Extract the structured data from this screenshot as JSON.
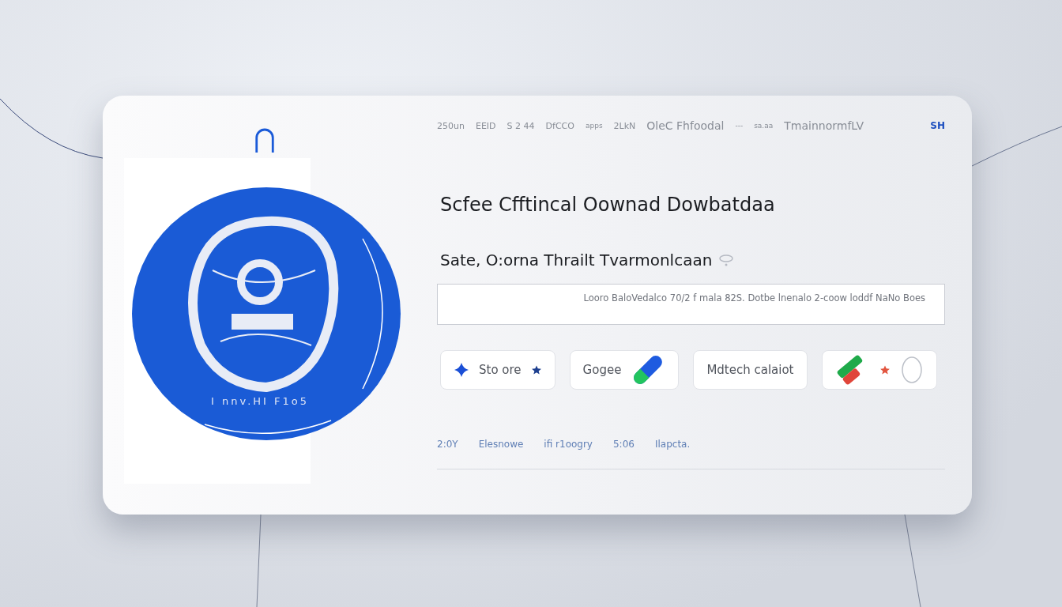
{
  "nav": {
    "items": [
      "250un",
      "EEID",
      "S 2 44",
      "DfCCO",
      "apps",
      "2LkN",
      "OleC Fhfoodal",
      "---",
      "sa.aa",
      "TmainnormfLV"
    ],
    "badge": "SH"
  },
  "emblem": {
    "caption": "I nnv.HI F1o5"
  },
  "heading": "Scfee Cfftincal Oownad Dowbatdaa",
  "subheading": "Sate, O:orna Thrailt Tvarmonlcaan",
  "field": {
    "value": "Looro BaloVedalco 70/2 f mala 82S. Dotbe lnenalo 2-coow loddf NaNo Boes"
  },
  "buttons": [
    {
      "kind": "diamond",
      "label": "Sto ore"
    },
    {
      "kind": "pill",
      "label": "Gogee"
    },
    {
      "kind": "text",
      "label": "Mdtech calaiot"
    },
    {
      "kind": "icons"
    }
  ],
  "footer": [
    "2:0Y",
    "Elesnowe",
    "ifi r1oogry",
    "5:06",
    "Ilapcta."
  ]
}
